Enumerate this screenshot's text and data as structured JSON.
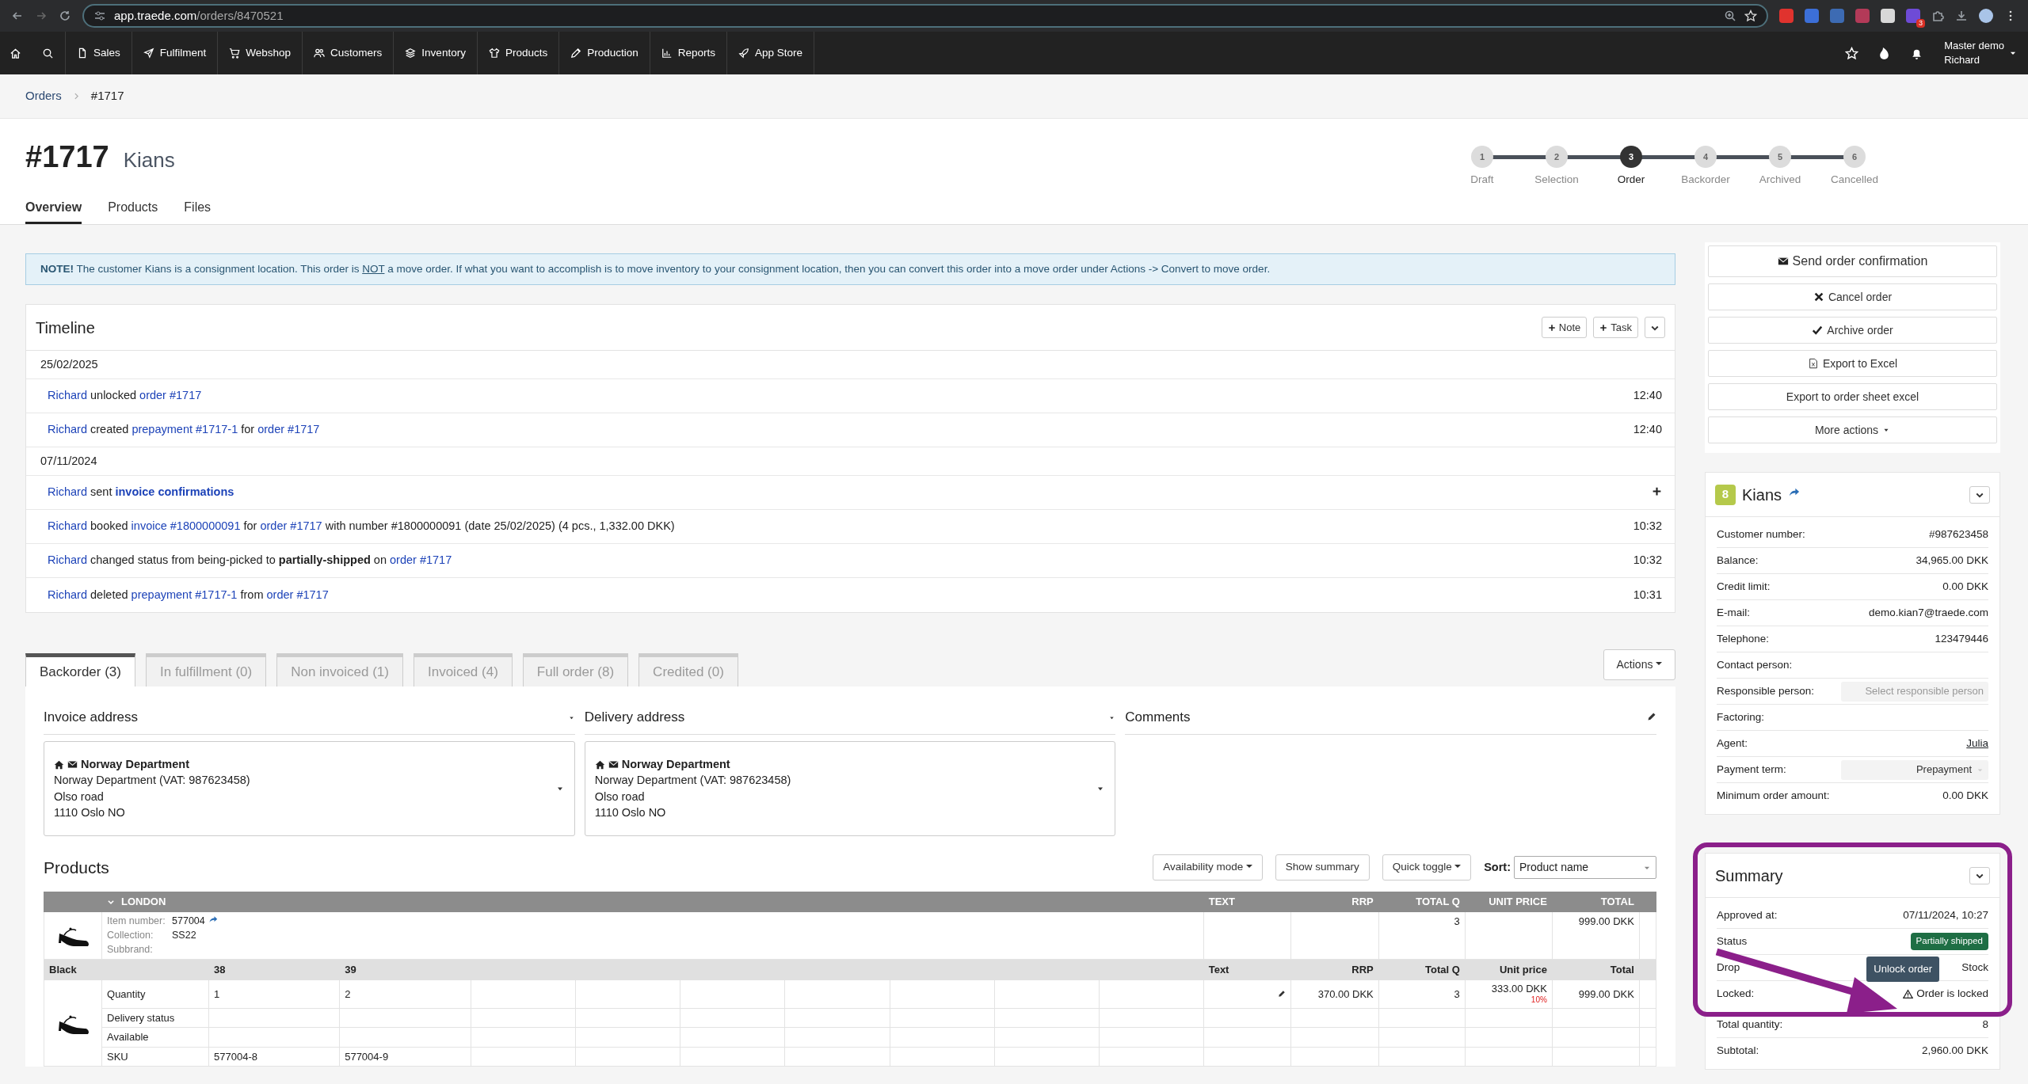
{
  "browser": {
    "host": "app.traede.com",
    "path": "/orders/8470521",
    "extension_badge": "3"
  },
  "nav": {
    "items": [
      "Sales",
      "Fulfilment",
      "Webshop",
      "Customers",
      "Inventory",
      "Products",
      "Production",
      "Reports",
      "App Store"
    ],
    "user_line1": "Master demo",
    "user_line2": "Richard"
  },
  "breadcrumb": [
    "Orders",
    "#1717"
  ],
  "header": {
    "number": "#1717",
    "customer": "Kians"
  },
  "page_tabs": [
    {
      "label": "Overview",
      "selected": true
    },
    {
      "label": "Products",
      "selected": false
    },
    {
      "label": "Files",
      "selected": false
    }
  ],
  "steps": [
    {
      "number": "1",
      "label": "Draft",
      "selected": false
    },
    {
      "number": "2",
      "label": "Selection",
      "selected": false
    },
    {
      "number": "3",
      "label": "Order",
      "selected": true
    },
    {
      "number": "4",
      "label": "Backorder",
      "selected": false
    },
    {
      "number": "5",
      "label": "Archived",
      "selected": false
    },
    {
      "number": "6",
      "label": "Cancelled",
      "selected": false
    }
  ],
  "notice": {
    "lead": "NOTE!",
    "before": "The customer Kians is a consignment location. This order is",
    "emphasis": "NOT",
    "after": "a move order. If what you want to accomplish is to move inventory to your consignment location, then you can convert this order into a move order under Actions -> Convert to move order."
  },
  "timeline": {
    "title": "Timeline",
    "buttons": [
      "Note",
      "Task"
    ],
    "groups": [
      {
        "date": "25/02/2025",
        "entries": [
          {
            "segments": [
              {
                "text": "Richard",
                "kind": "link"
              },
              {
                "text": "unlocked",
                "kind": "plain"
              },
              {
                "text": "order #1717",
                "kind": "link"
              }
            ],
            "time": "12:40",
            "expandable": false
          },
          {
            "segments": [
              {
                "text": "Richard",
                "kind": "link"
              },
              {
                "text": "created",
                "kind": "plain"
              },
              {
                "text": "prepayment #1717-1",
                "kind": "link"
              },
              {
                "text": "for",
                "kind": "plain"
              },
              {
                "text": "order #1717",
                "kind": "link"
              }
            ],
            "time": "12:40",
            "expandable": false
          }
        ]
      },
      {
        "date": "07/11/2024",
        "entries": [
          {
            "segments": [
              {
                "text": "Richard",
                "kind": "link"
              },
              {
                "text": "sent",
                "kind": "plain"
              },
              {
                "text": "invoice confirmations",
                "kind": "bold-link"
              }
            ],
            "expandable": true
          },
          {
            "segments": [
              {
                "text": "Richard",
                "kind": "link"
              },
              {
                "text": "booked",
                "kind": "plain"
              },
              {
                "text": "invoice #1800000091",
                "kind": "link"
              },
              {
                "text": "for",
                "kind": "plain"
              },
              {
                "text": "order #1717",
                "kind": "link"
              },
              {
                "text": "with number #1800000091 (date 25/02/2025) (4 pcs., 1,332.00 DKK)",
                "kind": "plain"
              }
            ],
            "time": "10:32",
            "expandable": false
          },
          {
            "segments": [
              {
                "text": "Richard",
                "kind": "link"
              },
              {
                "text": "changed status from being-picked to",
                "kind": "plain"
              },
              {
                "text": "partially-shipped",
                "kind": "bold"
              },
              {
                "text": "on",
                "kind": "plain"
              },
              {
                "text": "order #1717",
                "kind": "link"
              }
            ],
            "time": "10:32",
            "expandable": false
          },
          {
            "segments": [
              {
                "text": "Richard",
                "kind": "link"
              },
              {
                "text": "deleted",
                "kind": "plain"
              },
              {
                "text": "prepayment #1717-1",
                "kind": "link"
              },
              {
                "text": "from",
                "kind": "plain"
              },
              {
                "text": "order #1717",
                "kind": "link"
              }
            ],
            "time": "10:31",
            "expandable": false
          }
        ]
      }
    ]
  },
  "order_tabs": [
    {
      "label": "Backorder (3)",
      "selected": true
    },
    {
      "label": "In fulfillment (0)",
      "selected": false
    },
    {
      "label": "Non invoiced (1)",
      "selected": false
    },
    {
      "label": "Invoiced (4)",
      "selected": false
    },
    {
      "label": "Full order (8)",
      "selected": false
    },
    {
      "label": "Credited (0)",
      "selected": false
    }
  ],
  "actions_button": "Actions",
  "addresses": [
    {
      "title": "Invoice address",
      "name": "Norway Department",
      "lines": [
        "Norway Department (VAT: 987623458)",
        "Olso road",
        "1110 Oslo NO"
      ]
    },
    {
      "title": "Delivery address",
      "name": "Norway Department",
      "lines": [
        "Norway Department (VAT: 987623458)",
        "Olso road",
        "1110 Oslo NO"
      ]
    }
  ],
  "comments_title": "Comments",
  "products": {
    "title": "Products",
    "controls": [
      {
        "label": "Availability mode",
        "dropdown": true
      },
      {
        "label": "Show summary",
        "dropdown": false
      },
      {
        "label": "Quick toggle",
        "dropdown": true
      }
    ],
    "sort_label": "Sort:",
    "sort_value": "Product name",
    "table": {
      "group": "LONDON",
      "expanded": true,
      "headers": [
        "TEXT",
        "RRP",
        "TOTAL Q",
        "UNIT PRICE",
        "TOTAL"
      ],
      "product": {
        "fields": [
          {
            "label": "Item number:",
            "value": "577004",
            "linked": true
          },
          {
            "label": "Collection:",
            "value": "SS22",
            "linked": false
          },
          {
            "label": "Subbrand:",
            "linked": false
          }
        ],
        "total_q": "3",
        "total": "999.00 DKK"
      },
      "variant_name": "Black",
      "sizes": [
        "38",
        "39"
      ],
      "variant_headers": [
        "Text",
        "RRP",
        "Total Q",
        "Unit price",
        "Total"
      ],
      "rows": [
        {
          "label": "Quantity",
          "cells": [
            "1",
            "2"
          ],
          "editable": true,
          "rrp": "370.00 DKK",
          "total_q": "3",
          "unit_price": "333.00 DKK",
          "discount": "10%",
          "total": "999.00 DKK"
        },
        {
          "label": "Delivery status",
          "cells": [],
          "editable": false
        },
        {
          "label": "Available",
          "cells": [],
          "editable": false
        },
        {
          "label": "SKU",
          "cells": [
            "577004-8",
            "577004-9"
          ],
          "editable": false
        }
      ]
    }
  },
  "actions": [
    {
      "label": "Send order confirmation",
      "dropdown": false
    },
    {
      "label": "Cancel order",
      "dropdown": false
    },
    {
      "label": "Archive order",
      "dropdown": false
    },
    {
      "label": "Export to Excel",
      "dropdown": false
    },
    {
      "label": "Export to order sheet excel",
      "dropdown": false
    },
    {
      "label": "More actions",
      "dropdown": true
    }
  ],
  "customer": {
    "badge": "8",
    "name": "Kians",
    "fields": [
      {
        "label": "Customer number:",
        "value": "#987623458",
        "kind": "text"
      },
      {
        "label": "Balance:",
        "value": "34,965.00 DKK",
        "kind": "text"
      },
      {
        "label": "Credit limit:",
        "value": "0.00 DKK",
        "kind": "text"
      },
      {
        "label": "E-mail:",
        "value": "demo.kian7@traede.com",
        "kind": "text"
      },
      {
        "label": "Telephone:",
        "value": "123479446",
        "kind": "text"
      },
      {
        "label": "Contact person:",
        "kind": "text"
      },
      {
        "label": "Responsible person:",
        "placeholder": "Select responsible person",
        "kind": "select"
      },
      {
        "label": "Factoring:",
        "kind": "text"
      },
      {
        "label": "Agent:",
        "value": "Julia",
        "kind": "link"
      },
      {
        "label": "Payment term:",
        "value": "Prepayment",
        "kind": "select"
      },
      {
        "label": "Minimum order amount:",
        "value": "0.00 DKK",
        "kind": "text"
      }
    ]
  },
  "summary": {
    "title": "Summary",
    "rows": [
      {
        "label": "Approved at:",
        "value": "07/11/2024, 10:27",
        "kind": "text"
      },
      {
        "label": "Status",
        "value": "Partially shipped",
        "kind": "badge"
      },
      {
        "label": "Drop",
        "value": "Stock",
        "kind": "text"
      },
      {
        "label": "Locked:",
        "value": "Order is locked",
        "kind": "locked",
        "tooltip": "Unlock order"
      },
      {
        "label": "Total quantity:",
        "value": "8",
        "kind": "text"
      },
      {
        "label": "Subtotal:",
        "value": "2,960.00 DKK",
        "kind": "text"
      }
    ]
  }
}
